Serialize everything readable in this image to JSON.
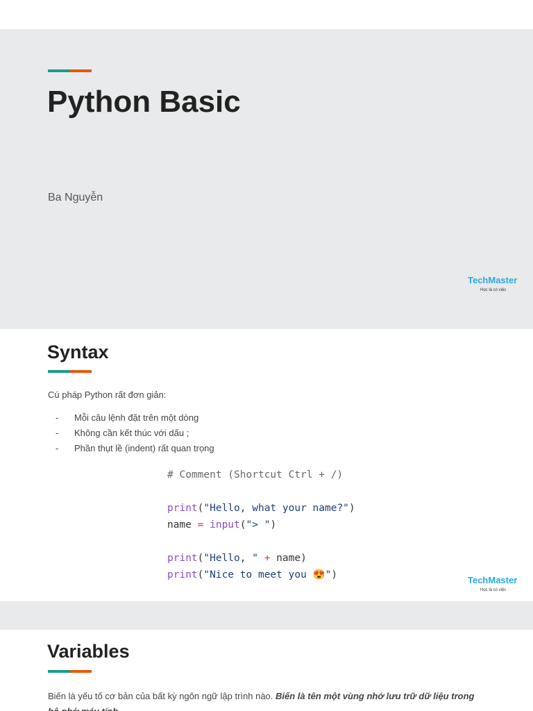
{
  "title_slide": {
    "title": "Python Basic",
    "author": "Ba Nguyễn"
  },
  "logo": {
    "brand": "TechMaster",
    "tagline": "Học là có việc"
  },
  "syntax": {
    "title": "Syntax",
    "intro": "Cú pháp Python rất đơn giản:",
    "bullets": [
      "Mỗi câu lệnh đặt trên một dòng",
      "Không cần kết thúc với dấu ;",
      "Phần thụt lề (indent) rất quan trọng"
    ],
    "code": {
      "comment": "# Comment (Shortcut Ctrl + /)",
      "l1": {
        "fn": "print",
        "open": "(",
        "str": "\"Hello, what your name?\"",
        "close": ")"
      },
      "l2": {
        "var": "name ",
        "op": "=",
        "fn": " input",
        "open": "(",
        "str": "\"> \"",
        "close": ")"
      },
      "l3": {
        "fn": "print",
        "open": "(",
        "str": "\"Hello, \"",
        "op": " + ",
        "var": "name",
        "close": ")"
      },
      "l4": {
        "fn": "print",
        "open": "(",
        "str": "\"Nice to meet you ",
        "emoji": "😍",
        "str2": "\"",
        "close": ")"
      }
    }
  },
  "variables": {
    "title": "Variables",
    "text": "Biến là yếu tố cơ bản của bất kỳ ngôn ngữ lập trình nào. ",
    "bold": "Biến là tên một vùng nhớ lưu trữ dữ liệu trong bộ nhớ máy tính."
  },
  "colors": {
    "teal": "#1a9b8a",
    "orange": "#e8580c",
    "logo": "#2ba8e0"
  }
}
